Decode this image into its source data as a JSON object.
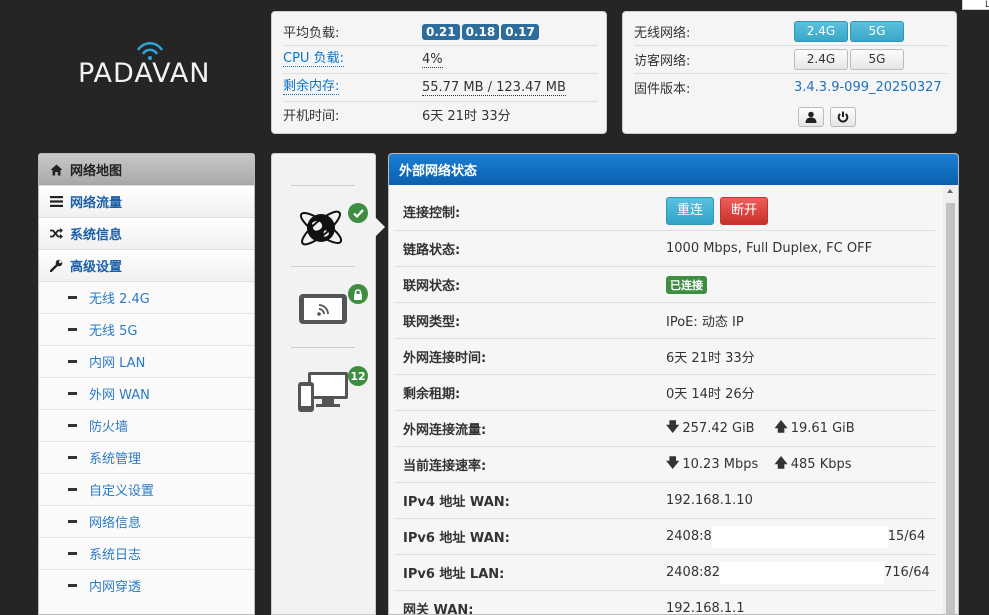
{
  "brand": {
    "logo_text": "PADAVAN"
  },
  "corner": {
    "label": "L"
  },
  "system": {
    "load_label": "平均负载:",
    "load_values": [
      "0.21",
      "0.18",
      "0.17"
    ],
    "cpu_label": "CPU 负载:",
    "cpu_value": "4%",
    "mem_label": "剩余内存:",
    "mem_free": "55.77 MB",
    "mem_sep": " / ",
    "mem_total": "123.47 MB",
    "uptime_label": "开机时间:",
    "uptime_value": "6天 21时 33分"
  },
  "wireless": {
    "wifi_label": "无线网络:",
    "guest_label": "访客网络:",
    "fw_label": "固件版本:",
    "fw_value": "3.4.3.9-099_20250327",
    "band_24": "2.4G",
    "band_5": "5G",
    "wifi_24_on": true,
    "wifi_5_on": true,
    "guest_24_on": false,
    "guest_5_on": false,
    "buttons": [
      "user-icon",
      "power-icon"
    ]
  },
  "sidebar": {
    "header": "网络地图",
    "items": [
      {
        "label": "网络流量",
        "icon": "list-icon"
      },
      {
        "label": "系统信息",
        "icon": "shuffle-icon"
      },
      {
        "label": "高级设置",
        "icon": "wrench-icon"
      }
    ],
    "subitems": [
      "无线 2.4G",
      "无线 5G",
      "内网 LAN",
      "外网 WAN",
      "防火墙",
      "系统管理",
      "自定义设置",
      "网络信息",
      "系统日志",
      "内网穿透"
    ]
  },
  "status_icons": {
    "internet": {
      "icon": "globe-icon",
      "badge": "check-icon"
    },
    "wireless": {
      "icon": "tablet-wifi-icon",
      "badge": "lock-icon"
    },
    "clients": {
      "icon": "devices-icon",
      "badge": "12"
    }
  },
  "main": {
    "title": "外部网络状态",
    "rows": [
      {
        "key": "连接控制:"
      },
      {
        "key": "链路状态:",
        "value": "1000 Mbps, Full Duplex, FC OFF"
      },
      {
        "key": "联网状态:",
        "value": "已连接"
      },
      {
        "key": "联网类型:",
        "value": "IPoE: 动态 IP"
      },
      {
        "key": "外网连接时间:",
        "value": "6天 21时 33分"
      },
      {
        "key": "剩余租期:",
        "value": "0天 14时 26分"
      },
      {
        "key": "外网连接流量:",
        "down": "257.42 GiB",
        "up": "19.61 GiB"
      },
      {
        "key": "当前连接速率:",
        "down": "10.23 Mbps",
        "up": "485 Kbps"
      },
      {
        "key": "IPv4 地址 WAN:",
        "value": "192.168.1.10"
      },
      {
        "key": "IPv6 地址 WAN:",
        "prefix": "2408:8",
        "suffix": "15/64"
      },
      {
        "key": "IPv6 地址 LAN:",
        "prefix": "2408:82",
        "suffix": "716/64"
      },
      {
        "key": "网关 WAN:",
        "value": "192.168.1.1"
      }
    ],
    "reconnect_label": "重连",
    "disconnect_label": "断开",
    "arrow_down": "🡇",
    "arrow_up": "🡅"
  }
}
